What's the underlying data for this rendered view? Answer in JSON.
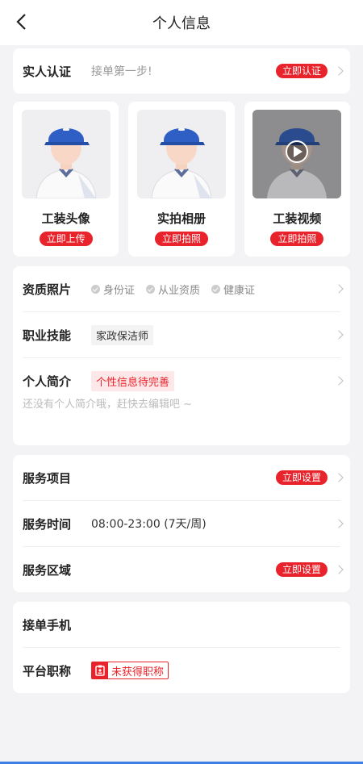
{
  "nav": {
    "title": "个人信息"
  },
  "realname": {
    "label": "实人认证",
    "hint": "接单第一步!",
    "action": "立即认证"
  },
  "photos": [
    {
      "label": "工装头像",
      "action": "立即上传"
    },
    {
      "label": "实拍相册",
      "action": "立即拍照"
    },
    {
      "label": "工装视频",
      "action": "立即拍照"
    }
  ],
  "profile": {
    "qualifications": {
      "label": "资质照片",
      "items": [
        "身份证",
        "从业资质",
        "健康证"
      ]
    },
    "skills": {
      "label": "职业技能",
      "tag": "家政保洁师"
    },
    "bio": {
      "label": "个人简介",
      "tag": "个性信息待完善",
      "placeholder": "还没有个人简介哦，赶快去编辑吧 ~"
    }
  },
  "service": {
    "items": {
      "label": "服务项目",
      "action": "立即设置"
    },
    "time": {
      "label": "服务时间",
      "value": "08:00-23:00 (7天/周)"
    },
    "area": {
      "label": "服务区域",
      "action": "立即设置"
    }
  },
  "contact": {
    "phone": {
      "label": "接单手机",
      "value": ""
    },
    "title": {
      "label": "平台职称",
      "tag": "未获得职称"
    }
  },
  "colors": {
    "accent": "#e9232b",
    "cap": "#2f5ec4"
  }
}
